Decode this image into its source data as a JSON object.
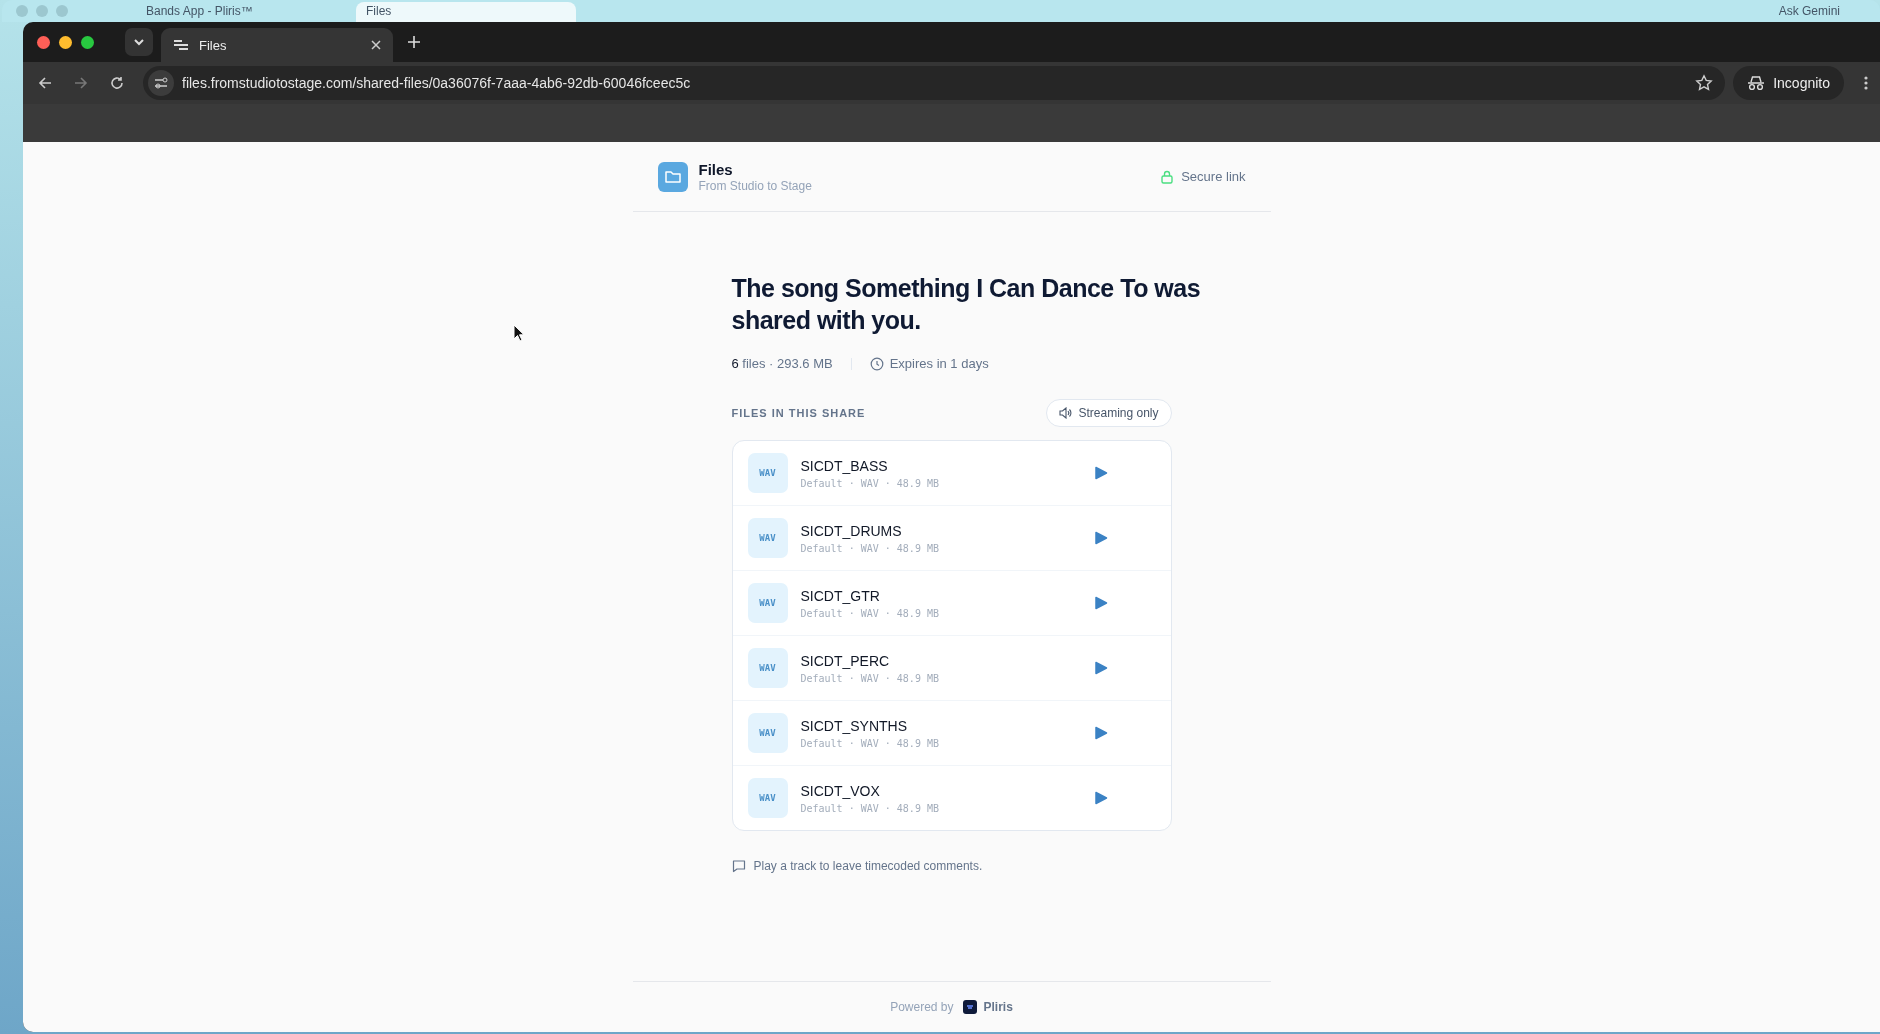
{
  "desktop": {
    "background_tabs": [
      {
        "title": "Bands App - Pliris™",
        "selected": false
      },
      {
        "title": "Files",
        "selected": true
      }
    ],
    "background_button": "Ask Gemini"
  },
  "browser": {
    "tabs": [
      {
        "title": "Files",
        "selected": true
      }
    ],
    "url": "files.fromstudiotostage.com/shared-files/0a36076f-7aaa-4ab6-92db-60046fceec5c",
    "profile": "Incognito"
  },
  "header": {
    "title": "Files",
    "subtitle": "From Studio to Stage",
    "secure": "Secure link"
  },
  "share": {
    "title": "The song Something I Can Dance To was shared with you.",
    "summary": "**6** files · 293.6 MB",
    "expires": "Expires in 1 days"
  },
  "files_section": {
    "label": "FILES IN THIS SHARE",
    "mode": "Streaming only"
  },
  "files": [
    {
      "badge": "WAV",
      "name": "SICDT_BASS",
      "meta": "Default · WAV · 48.9 MB"
    },
    {
      "badge": "WAV",
      "name": "SICDT_DRUMS",
      "meta": "Default · WAV · 48.9 MB"
    },
    {
      "badge": "WAV",
      "name": "SICDT_GTR",
      "meta": "Default · WAV · 48.9 MB"
    },
    {
      "badge": "WAV",
      "name": "SICDT_PERC",
      "meta": "Default · WAV · 48.9 MB"
    },
    {
      "badge": "WAV",
      "name": "SICDT_SYNTHS",
      "meta": "Default · WAV · 48.9 MB"
    },
    {
      "badge": "WAV",
      "name": "SICDT_VOX",
      "meta": "Default · WAV · 48.9 MB"
    }
  ],
  "note": "Play a track to leave timecoded comments.",
  "footer": {
    "powered_by": "Powered by",
    "brand": "Pliris"
  }
}
